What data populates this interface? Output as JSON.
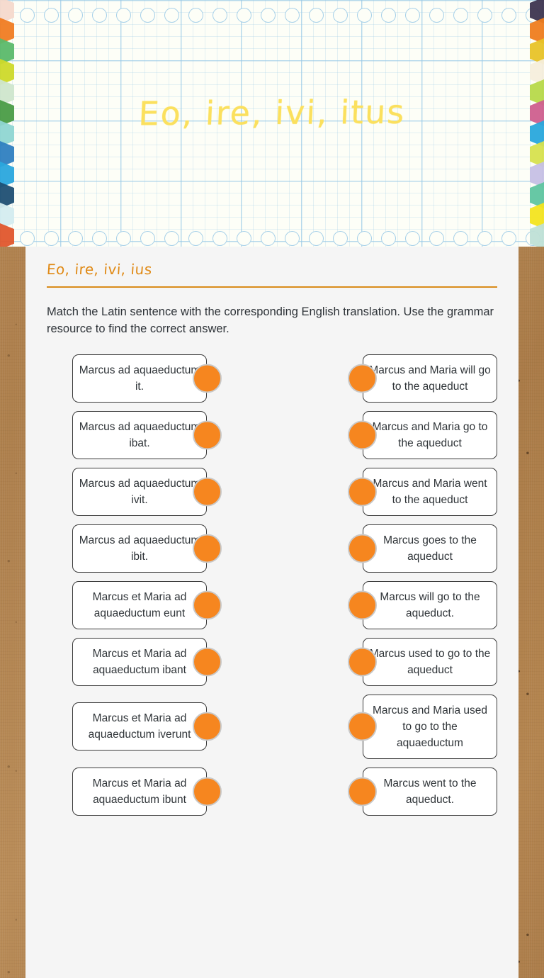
{
  "header": {
    "title": "Eo, ire, ivi, itus",
    "title_color": "#fbe05e",
    "paper_color": "#fdfef7",
    "grid_line_color": "#96c8e6",
    "hole_count": 22,
    "tab_colors_left": [
      "#f6d9cc",
      "#f07c22",
      "#5bb96a",
      "#cdd92a",
      "#cfe6cc",
      "#4a9c46",
      "#8fd6d2",
      "#2f7fc0",
      "#2aa6dd",
      "#1f4f73",
      "#d4ecef",
      "#e0562c"
    ],
    "tab_colors_right": [
      "#3d3550",
      "#ef7d1f",
      "#e8c328",
      "#f5eedc",
      "#b7d94a",
      "#cf5f8e",
      "#29a8dc",
      "#d7e24e",
      "#c6c0e5",
      "#5fc5a0",
      "#f3e41f",
      "#bfe0d6"
    ]
  },
  "card": {
    "title": "Eo, ire, ivi, ius",
    "title_color": "#e08a16",
    "rule_color": "#d98c1b",
    "instructions": "Match the Latin sentence with the corresponding English translation. Use the grammar resource to find the correct answer."
  },
  "activity": {
    "dot_color": "#f6861f",
    "dot_border_color": "#c9c9c9",
    "rows": [
      {
        "left": "Marcus ad aquaeductum it.",
        "right": "Marcus and Maria will go to the aqueduct"
      },
      {
        "left": "Marcus ad aquaeductum ibat.",
        "right": "Marcus and Maria go to the aqueduct"
      },
      {
        "left": "Marcus ad aquaeductum ivit.",
        "right": "Marcus and Maria went to the aqueduct"
      },
      {
        "left": "Marcus ad aquaeductum ibit.",
        "right": "Marcus goes to the aqueduct"
      },
      {
        "left": "Marcus et Maria ad aquaeductum eunt",
        "right": "Marcus will go to the aqueduct."
      },
      {
        "left": "Marcus et Maria ad aquaeductum ibant",
        "right": "Marcus used to go to the aqueduct"
      },
      {
        "left": "Marcus et Maria ad aquaeductum iverunt",
        "right": "Marcus and Maria used to go to the aquaeductum"
      },
      {
        "left": "Marcus et Maria ad aquaeductum ibunt",
        "right": "Marcus went to the aqueduct."
      }
    ]
  }
}
